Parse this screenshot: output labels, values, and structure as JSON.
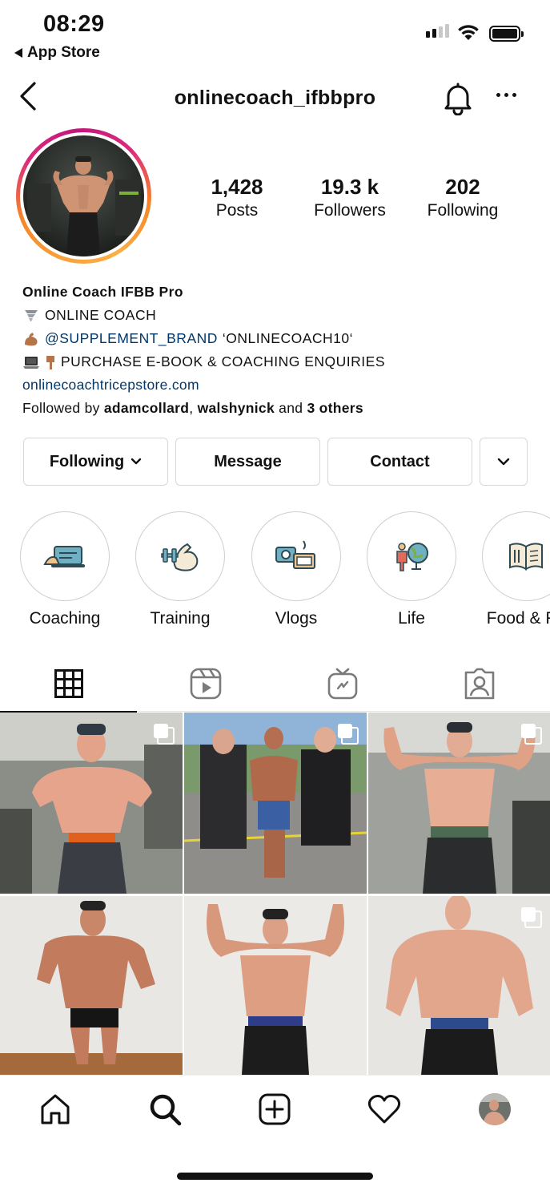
{
  "status_bar": {
    "time": "08:29",
    "back_app": "App Store"
  },
  "header": {
    "username": "onlinecoach_ifbbpro"
  },
  "stats": [
    {
      "value": "1,428",
      "label": "Posts"
    },
    {
      "value": "19.3 k",
      "label": "Followers"
    },
    {
      "value": "202",
      "label": "Following"
    }
  ],
  "bio": {
    "name": "Online Coach IFBB Pro",
    "line1": "ONLINE COACH",
    "mention": "@SUPPLEMENT_BRAND",
    "code": "‘ONLINECOACH10‘",
    "line3": "PURCHASE E-BOOK & COACHING ENQUIRIES",
    "link": "onlinecoachtricepstore.com",
    "followed_prefix": "Followed by",
    "followed_user1": "adamcollard",
    "followed_sep": ",",
    "followed_user2": "walshynick",
    "followed_and": "and",
    "followed_others": "3 others"
  },
  "buttons": {
    "following": "Following",
    "message": "Message",
    "contact": "Contact"
  },
  "highlights": [
    {
      "label": "Coaching",
      "icon": "coaching-icon"
    },
    {
      "label": "Training",
      "icon": "training-icon"
    },
    {
      "label": "Vlogs",
      "icon": "vlogs-icon"
    },
    {
      "label": "Life",
      "icon": "life-icon"
    },
    {
      "label": "Food & Re",
      "icon": "food-icon"
    }
  ],
  "tabs": [
    "grid-icon",
    "reels-icon",
    "igtv-icon",
    "tagged-icon"
  ],
  "nav": [
    "home-icon",
    "search-icon",
    "add-post-icon",
    "heart-icon",
    "profile-avatar"
  ],
  "colors": {
    "link": "#00376b",
    "ring_start": "#f58529",
    "ring_end": "#dd2a7b",
    "border": "#d8d8d8"
  }
}
